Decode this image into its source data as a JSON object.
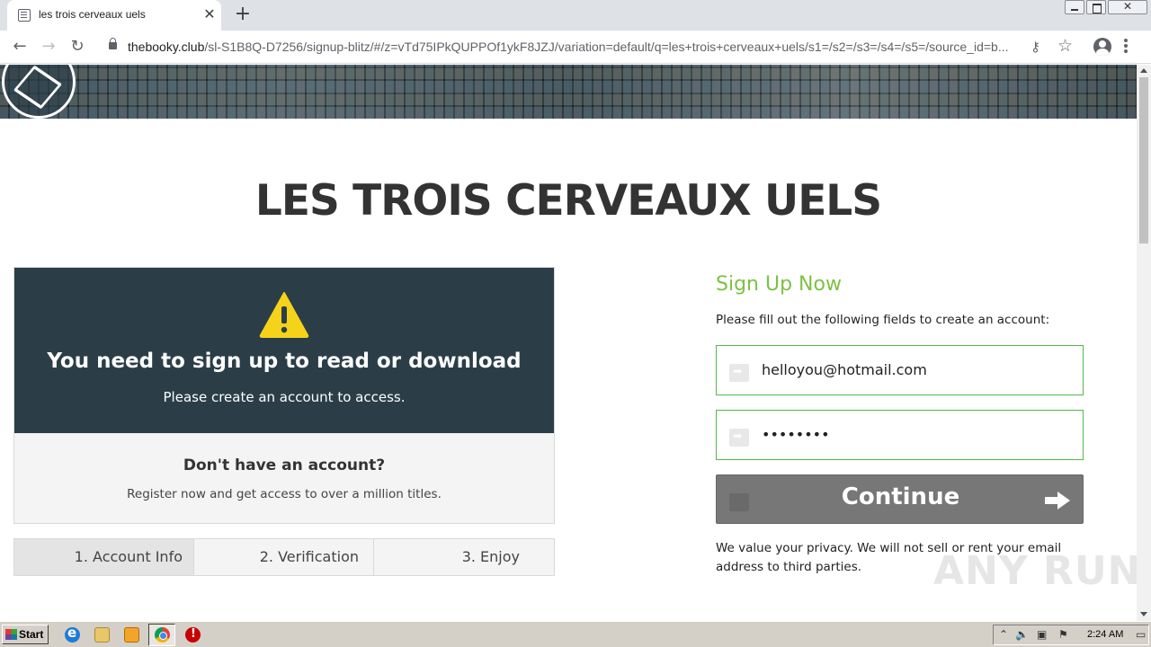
{
  "browser": {
    "tab_title": "les trois cerveaux uels",
    "tab_close": "✕",
    "new_tab": "+",
    "url_host": "thebooky.club",
    "url_path": "/sl-S1B8Q-D7256/signup-blitz/#/z=vTd75IPkQUPPOf1ykF8JZJ/variation=default/q=les+trois+cerveaux+uels/s1=/s2=/s3=/s4=/s5=/source_id=b..."
  },
  "page": {
    "title": "LES TROIS CERVEAUX UELS",
    "card": {
      "heading": "You need to sign up to read or download",
      "subheading": "Please create an account to access.",
      "question": "Don't have an account?",
      "question_sub": "Register now and get access to over a million titles."
    },
    "steps": [
      {
        "label": "1. Account Info",
        "active": true
      },
      {
        "label": "2. Verification",
        "active": false
      },
      {
        "label": "3. Enjoy",
        "active": false
      }
    ],
    "form": {
      "title": "Sign Up Now",
      "description": "Please fill out the following fields to create an account:",
      "email_value": "helloyou@hotmail.com",
      "password_value": "••••••••",
      "continue_label": "Continue",
      "privacy_text": "We value your privacy. We will not sell or rent your email address to third parties."
    },
    "watermark": "ANY RUN"
  },
  "taskbar": {
    "start_label": "Start",
    "clock": "2:24 AM"
  },
  "colors": {
    "card_dark": "#2b3e48",
    "accent_green": "#7dc243",
    "field_border": "#52b948",
    "button_gray": "#777777",
    "warning_yellow": "#f5d31a"
  }
}
